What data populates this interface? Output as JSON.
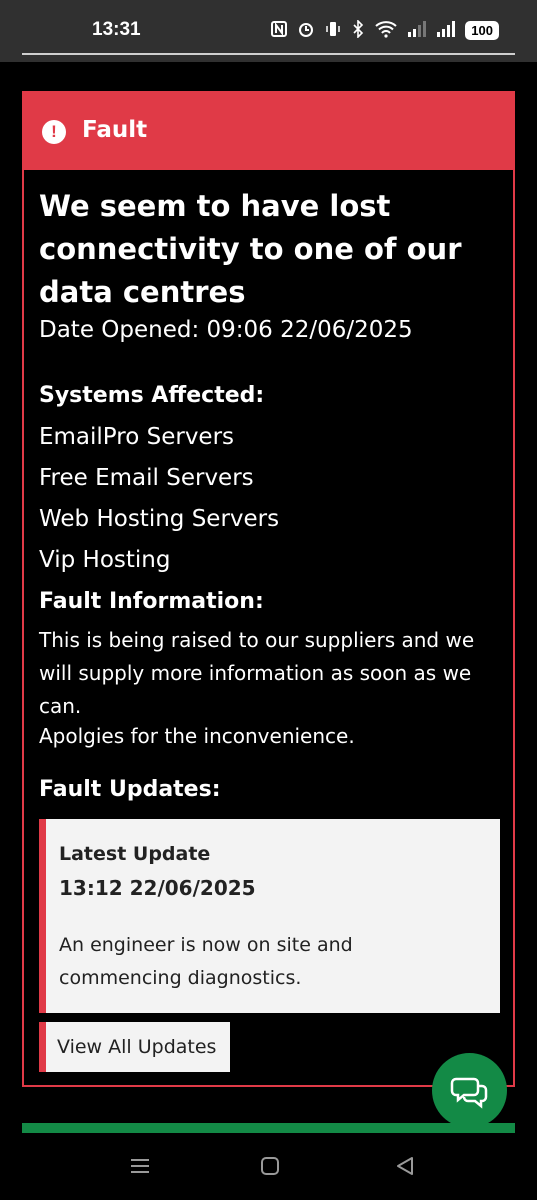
{
  "status_bar": {
    "time": "13:31",
    "battery": "100",
    "icons": [
      "nfc-icon",
      "alarm-icon",
      "vibrate-icon",
      "bluetooth-icon",
      "wifi-icon",
      "signal-icon",
      "signal-icon-2",
      "battery-icon"
    ]
  },
  "fault": {
    "label": "Fault",
    "title": "We seem to have lost connectivity to one of our data centres",
    "date_opened": "Date Opened: 09:06 22/06/2025",
    "systems_heading": "Systems Affected:",
    "systems": [
      "EmailPro Servers",
      "Free Email Servers",
      "Web Hosting Servers",
      "Vip Hosting"
    ],
    "info_heading": "Fault Information:",
    "info_text": "This is being raised to our suppliers and we will supply more information as soon as we can.",
    "apology": "Apolgies for the inconvenience.",
    "updates_heading": "Fault Updates:",
    "latest_update": {
      "title": "Latest Update",
      "time": "13:12 22/06/2025",
      "text": "An engineer is now on site and commencing diagnostics."
    },
    "view_all_label": "View All Updates"
  },
  "colors": {
    "accent_red": "#e03a47",
    "chat_green": "#138a46"
  }
}
